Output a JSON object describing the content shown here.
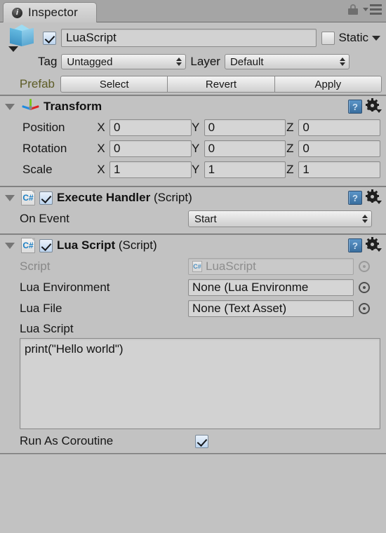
{
  "window": {
    "tab_label": "Inspector",
    "tab_icon": "info-icon",
    "lock_icon": "lock-icon",
    "menu_icon": "hamburger-menu-icon"
  },
  "gameobject": {
    "icon": "cube-icon",
    "enabled": true,
    "name": "LuaScript",
    "static_label": "Static",
    "static_checked": false,
    "tag_label": "Tag",
    "tag_value": "Untagged",
    "layer_label": "Layer",
    "layer_value": "Default"
  },
  "prefab": {
    "label": "Prefab",
    "buttons": [
      "Select",
      "Revert",
      "Apply"
    ]
  },
  "transform": {
    "title": "Transform",
    "icon": "transform-axis-icon",
    "expanded": true,
    "rows": [
      {
        "label": "Position",
        "x": "0",
        "y": "0",
        "z": "0"
      },
      {
        "label": "Rotation",
        "x": "0",
        "y": "0",
        "z": "0"
      },
      {
        "label": "Scale",
        "x": "1",
        "y": "1",
        "z": "1"
      }
    ],
    "axes": [
      "X",
      "Y",
      "Z"
    ]
  },
  "execute_handler": {
    "title": "Execute Handler",
    "title_suffix": " (Script)",
    "enabled": true,
    "expanded": true,
    "icon": "csharp-script-icon",
    "on_event_label": "On Event",
    "on_event_value": "Start"
  },
  "lua_script": {
    "title": "Lua Script",
    "title_suffix": " (Script)",
    "enabled": true,
    "expanded": true,
    "icon": "csharp-script-icon",
    "script_label": "Script",
    "script_value": "LuaScript",
    "lua_environment_label": "Lua Environment",
    "lua_environment_value": "None (Lua Environme",
    "lua_file_label": "Lua File",
    "lua_file_value": "None (Text Asset)",
    "lua_script_label": "Lua Script",
    "lua_script_text": "print(\"Hello world\")",
    "run_as_coroutine_label": "Run As Coroutine",
    "run_as_coroutine_checked": true
  },
  "colors": {
    "panel_bg": "#c2c2c2",
    "tabbar_bg": "#a5a5a5",
    "field_bg": "#d5d5d5",
    "prefab_label": "#5d5c26",
    "accent_blue": "#3a6f9f"
  }
}
